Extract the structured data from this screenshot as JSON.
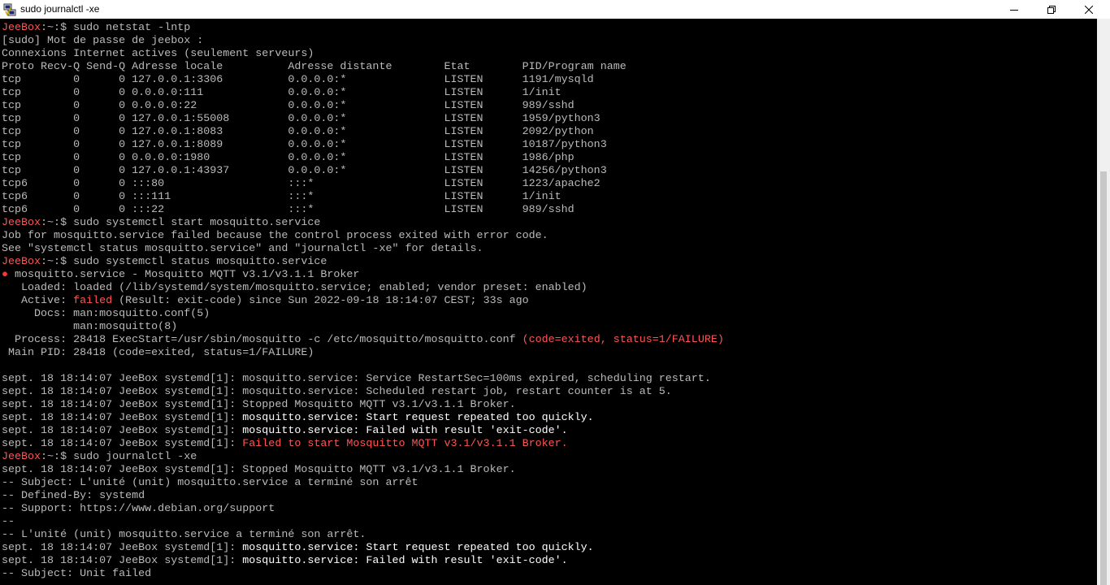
{
  "window": {
    "title": "sudo journalctl -xe",
    "controls": {
      "minimize": "minimize-icon",
      "maximize": "restore-icon",
      "close": "close-icon"
    }
  },
  "colors": {
    "background": "#000000",
    "default": "#bbbbbb",
    "prompt": "#ff5555",
    "red": "#ff5555",
    "bold": "#ffffff",
    "bullet": "#ff3333",
    "titlebar": "#ffffff"
  },
  "terminal": {
    "lines": [
      [
        {
          "t": "JeeBox",
          "c": "prompt"
        },
        {
          "t": ":~:$ sudo netstat -lntp"
        }
      ],
      [
        {
          "t": "[sudo] Mot de passe de jeebox :"
        }
      ],
      [
        {
          "t": "Connexions Internet actives (seulement serveurs)"
        }
      ],
      [
        {
          "t": "Proto Recv-Q Send-Q Adresse locale          Adresse distante        Etat        PID/Program name"
        }
      ],
      [
        {
          "t": "tcp        0      0 127.0.0.1:3306          0.0.0.0:*               LISTEN      1191/mysqld"
        }
      ],
      [
        {
          "t": "tcp        0      0 0.0.0.0:111             0.0.0.0:*               LISTEN      1/init"
        }
      ],
      [
        {
          "t": "tcp        0      0 0.0.0.0:22              0.0.0.0:*               LISTEN      989/sshd"
        }
      ],
      [
        {
          "t": "tcp        0      0 127.0.0.1:55008         0.0.0.0:*               LISTEN      1959/python3"
        }
      ],
      [
        {
          "t": "tcp        0      0 127.0.0.1:8083          0.0.0.0:*               LISTEN      2092/python"
        }
      ],
      [
        {
          "t": "tcp        0      0 127.0.0.1:8089          0.0.0.0:*               LISTEN      10187/python3"
        }
      ],
      [
        {
          "t": "tcp        0      0 0.0.0.0:1980            0.0.0.0:*               LISTEN      1986/php"
        }
      ],
      [
        {
          "t": "tcp        0      0 127.0.0.1:43937         0.0.0.0:*               LISTEN      14256/python3"
        }
      ],
      [
        {
          "t": "tcp6       0      0 :::80                   :::*                    LISTEN      1223/apache2"
        }
      ],
      [
        {
          "t": "tcp6       0      0 :::111                  :::*                    LISTEN      1/init"
        }
      ],
      [
        {
          "t": "tcp6       0      0 :::22                   :::*                    LISTEN      989/sshd"
        }
      ],
      [
        {
          "t": "JeeBox",
          "c": "prompt"
        },
        {
          "t": ":~:$ sudo systemctl start mosquitto.service"
        }
      ],
      [
        {
          "t": "Job for mosquitto.service failed because the control process exited with error code."
        }
      ],
      [
        {
          "t": "See \"systemctl status mosquitto.service\" and \"journalctl -xe\" for details."
        }
      ],
      [
        {
          "t": "JeeBox",
          "c": "prompt"
        },
        {
          "t": ":~:$ sudo systemctl status mosquitto.service"
        }
      ],
      [
        {
          "t": "●",
          "c": "bullet"
        },
        {
          "t": " mosquitto.service - Mosquitto MQTT v3.1/v3.1.1 Broker"
        }
      ],
      [
        {
          "t": "   Loaded: loaded (/lib/systemd/system/mosquitto.service; enabled; vendor preset: enabled)"
        }
      ],
      [
        {
          "t": "   Active: "
        },
        {
          "t": "failed",
          "c": "red"
        },
        {
          "t": " (Result: exit-code) since Sun 2022-09-18 18:14:07 CEST; 33s ago"
        }
      ],
      [
        {
          "t": "     Docs: man:mosquitto.conf(5)"
        }
      ],
      [
        {
          "t": "           man:mosquitto(8)"
        }
      ],
      [
        {
          "t": "  Process: 28418 ExecStart=/usr/sbin/mosquitto -c /etc/mosquitto/mosquitto.conf "
        },
        {
          "t": "(code=exited, status=1/FAILURE)",
          "c": "red"
        }
      ],
      [
        {
          "t": " Main PID: 28418 (code=exited, status=1/FAILURE)"
        }
      ],
      [
        {
          "t": ""
        }
      ],
      [
        {
          "t": "sept. 18 18:14:07 JeeBox systemd[1]: mosquitto.service: Service RestartSec=100ms expired, scheduling restart."
        }
      ],
      [
        {
          "t": "sept. 18 18:14:07 JeeBox systemd[1]: mosquitto.service: Scheduled restart job, restart counter is at 5."
        }
      ],
      [
        {
          "t": "sept. 18 18:14:07 JeeBox systemd[1]: Stopped Mosquitto MQTT v3.1/v3.1.1 Broker."
        }
      ],
      [
        {
          "t": "sept. 18 18:14:07 JeeBox systemd[1]: "
        },
        {
          "t": "mosquitto.service: Start request repeated too quickly.",
          "c": "bold"
        }
      ],
      [
        {
          "t": "sept. 18 18:14:07 JeeBox systemd[1]: "
        },
        {
          "t": "mosquitto.service: Failed with result 'exit-code'.",
          "c": "bold"
        }
      ],
      [
        {
          "t": "sept. 18 18:14:07 JeeBox systemd[1]: "
        },
        {
          "t": "Failed to start Mosquitto MQTT v3.1/v3.1.1 Broker.",
          "c": "red"
        }
      ],
      [
        {
          "t": "JeeBox",
          "c": "prompt"
        },
        {
          "t": ":~:$ sudo journalctl -xe"
        }
      ],
      [
        {
          "t": "sept. 18 18:14:07 JeeBox systemd[1]: Stopped Mosquitto MQTT v3.1/v3.1.1 Broker."
        }
      ],
      [
        {
          "t": "-- Subject: L'unité (unit) mosquitto.service a terminé son arrêt"
        }
      ],
      [
        {
          "t": "-- Defined-By: systemd"
        }
      ],
      [
        {
          "t": "-- Support: https://www.debian.org/support"
        }
      ],
      [
        {
          "t": "--"
        }
      ],
      [
        {
          "t": "-- L'unité (unit) mosquitto.service a terminé son arrêt."
        }
      ],
      [
        {
          "t": "sept. 18 18:14:07 JeeBox systemd[1]: "
        },
        {
          "t": "mosquitto.service: Start request repeated too quickly.",
          "c": "bold"
        }
      ],
      [
        {
          "t": "sept. 18 18:14:07 JeeBox systemd[1]: "
        },
        {
          "t": "mosquitto.service: Failed with result 'exit-code'.",
          "c": "bold"
        }
      ],
      [
        {
          "t": "-- Subject: Unit failed"
        }
      ]
    ]
  }
}
